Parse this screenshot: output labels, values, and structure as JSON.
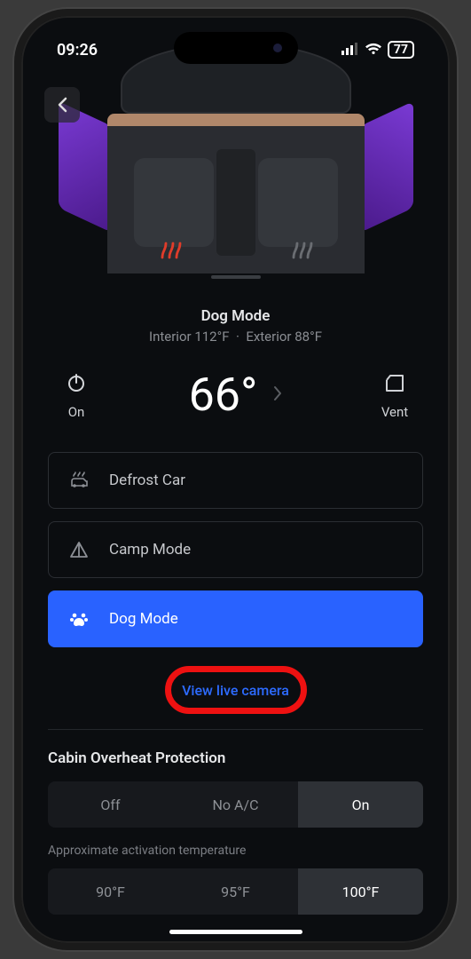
{
  "status": {
    "time": "09:26",
    "battery": "77"
  },
  "climate": {
    "mode_title": "Dog Mode",
    "interior_label": "Interior 112°F",
    "exterior_label": "Exterior 88°F",
    "power_label": "On",
    "temp_display": "66°",
    "vent_label": "Vent"
  },
  "options": {
    "defrost": "Defrost Car",
    "camp": "Camp Mode",
    "dog": "Dog Mode"
  },
  "live_camera": "View live camera",
  "overheat": {
    "title": "Cabin Overheat Protection",
    "opts": {
      "off": "Off",
      "noac": "No A/C",
      "on": "On"
    },
    "sub": "Approximate activation temperature",
    "temps": {
      "t90": "90°F",
      "t95": "95°F",
      "t100": "100°F"
    }
  }
}
